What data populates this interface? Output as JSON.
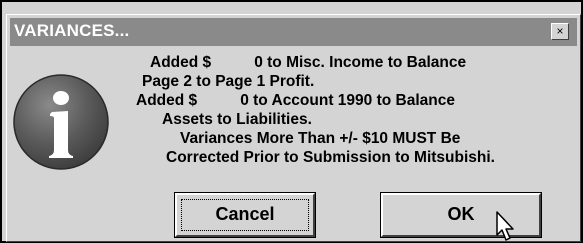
{
  "dialog": {
    "title": "VARIANCES...",
    "close_glyph": "×",
    "icon": "information-icon",
    "message_lines": [
      "Added $          0 to Misc. Income to Balance",
      "Page 2 to Page 1 Profit.",
      "Added $          0 to Account 1990 to Balance",
      "Assets to Liabilities.",
      "Variances More Than +/- $10 MUST Be",
      "Corrected Prior to Submission to Mitsubishi."
    ],
    "buttons": {
      "cancel_label": "Cancel",
      "ok_label": "OK"
    }
  },
  "colors": {
    "titlebar": "#8a8a8a",
    "face": "#d4d4d4",
    "icon_fill": "#5a5a5a"
  }
}
